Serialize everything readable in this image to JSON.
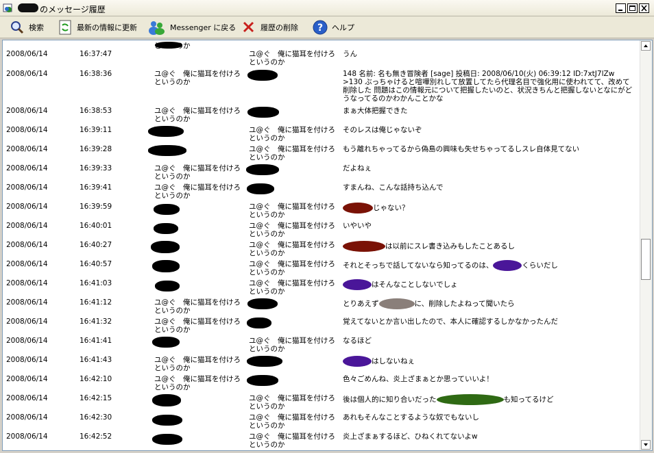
{
  "window": {
    "title": "のメッセージ履歴"
  },
  "toolbar": {
    "search_label": "検索",
    "refresh_label": "最新の情報に更新",
    "messenger_label": "Messenger に戻る",
    "delete_label": "履歴の削除",
    "help_label": "ヘルプ"
  },
  "nick": "ユ@ぐ　俺に猫耳を付けろというのか",
  "messages": [
    {
      "date": "2008/06/14",
      "time": "16:37:47",
      "from": "",
      "to": "nick",
      "from_line2": "というのか",
      "msg": "うん"
    },
    {
      "date": "2008/06/14",
      "time": "16:38:36",
      "from": "nick",
      "to": "",
      "msg": "148 名前: 名も無き冒険者 [sage] 投稿日: 2008/06/10(火) 06:39:12 ID:7xtJ7lZw >130 ぶっちゃけると喧嘩別れして放置してたら代理名目で強化用に使われてて、改めて削除した 問題はこの情報元について把握したいのと、状況きちんと把握しないとなにがどうなってるのかわかんことかな"
    },
    {
      "date": "2008/06/14",
      "time": "16:38:53",
      "from": "nick",
      "to": "",
      "msg": "まぁ大体把握できた"
    },
    {
      "date": "2008/06/14",
      "time": "16:39:11",
      "from": "",
      "to": "nick",
      "msg": "そのレスは俺じゃないぞ"
    },
    {
      "date": "2008/06/14",
      "time": "16:39:28",
      "from": "",
      "to": "nick",
      "msg": "もう離れちゃってるから偽島の興味も失せちゃってるしスレ自体見てない"
    },
    {
      "date": "2008/06/14",
      "time": "16:39:33",
      "from": "nick",
      "to": "",
      "msg": "だよねぇ"
    },
    {
      "date": "2008/06/14",
      "time": "16:39:41",
      "from": "nick",
      "to": "",
      "msg": "すまんね、こんな話持ち込んで"
    },
    {
      "date": "2008/06/14",
      "time": "16:39:59",
      "from": "",
      "to": "nick",
      "msg_pre": "",
      "msg": "じゃない？"
    },
    {
      "date": "2008/06/14",
      "time": "16:40:01",
      "from": "",
      "to": "nick",
      "msg": "いやいや"
    },
    {
      "date": "2008/06/14",
      "time": "16:40:27",
      "from": "",
      "to": "nick",
      "msg": "は以前にスレ書き込みもしたことあるし"
    },
    {
      "date": "2008/06/14",
      "time": "16:40:57",
      "from": "",
      "to": "nick",
      "msg": "それとそっちで話してないなら知ってるのは、",
      "msg_post": "くらいだし"
    },
    {
      "date": "2008/06/14",
      "time": "16:41:03",
      "from": "",
      "to": "nick",
      "msg": "はそんなことしないでしょ"
    },
    {
      "date": "2008/06/14",
      "time": "16:41:12",
      "from": "nick",
      "to": "",
      "msg": "とりあえず",
      "msg_post": "に、削除したよねって聞いたら"
    },
    {
      "date": "2008/06/14",
      "time": "16:41:32",
      "from": "nick",
      "to": "",
      "msg": "覚えてないとか言い出したので、本人に確認するしかなかったんだ"
    },
    {
      "date": "2008/06/14",
      "time": "16:41:41",
      "from": "",
      "to": "nick",
      "msg": "なるほど"
    },
    {
      "date": "2008/06/14",
      "time": "16:41:43",
      "from": "nick",
      "to": "",
      "msg": "はしないねぇ"
    },
    {
      "date": "2008/06/14",
      "time": "16:42:10",
      "from": "nick",
      "to": "",
      "msg": "色々ごめんね、炎上ざまぁとか思っていいよ！"
    },
    {
      "date": "2008/06/14",
      "time": "16:42:15",
      "from": "",
      "to": "nick",
      "msg": "後は個人的に知り合いだった",
      "msg_post": "も知ってるけど"
    },
    {
      "date": "2008/06/14",
      "time": "16:42:30",
      "from": "",
      "to": "nick",
      "msg": "あれもそんなことするような奴でもないし"
    },
    {
      "date": "2008/06/14",
      "time": "16:42:52",
      "from": "",
      "to": "nick",
      "msg": "炎上ざまぁするほど、ひねくれてないよw"
    }
  ],
  "colors": {
    "redact_red": "#7a1206",
    "redact_purple": "#4a1699",
    "redact_gray": "#8a7f7a",
    "redact_green": "#2f6a14"
  }
}
